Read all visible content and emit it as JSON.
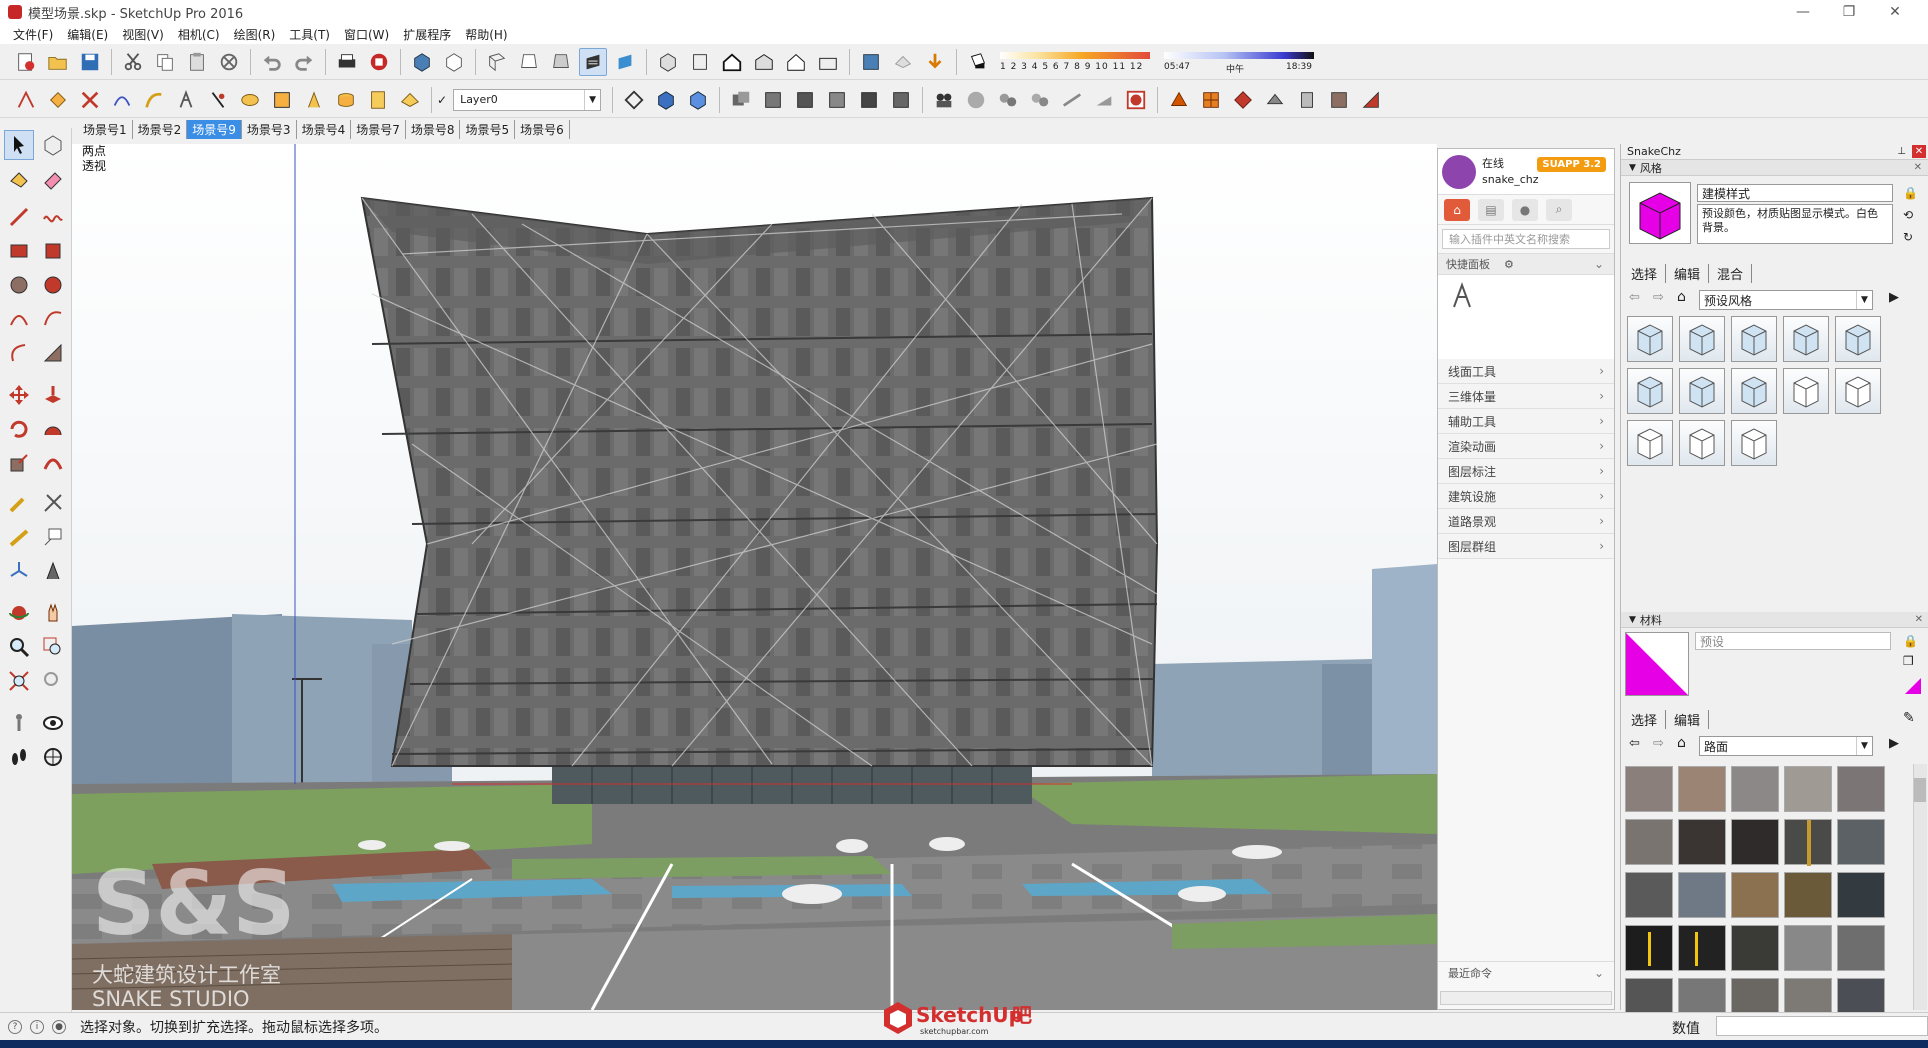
{
  "window": {
    "title": "模型场景.skp - SketchUp Pro 2016",
    "controls": [
      "—",
      "❐",
      "✕"
    ]
  },
  "menu": [
    "文件(F)",
    "编辑(E)",
    "视图(V)",
    "相机(C)",
    "绘图(R)",
    "工具(T)",
    "窗口(W)",
    "扩展程序",
    "帮助(H)"
  ],
  "toolbar2": {
    "layer_check": "✓",
    "layer_name": "Layer0",
    "shadow": {
      "months": "1 2 3 4 5 6 7 8 9 10 11 12",
      "time_start": "05:47",
      "time_mid": "中午",
      "time_end": "18:39"
    }
  },
  "scene_tabs": [
    "场景号1",
    "场景号2",
    "场景号9",
    "场景号3",
    "场景号4",
    "场景号7",
    "场景号8",
    "场景号5",
    "场景号6"
  ],
  "active_scene": "场景号9",
  "viewport": {
    "camera_line1": "两点",
    "camera_line2": "透视",
    "watermark_logo": "S&S",
    "watermark_cn": "大蛇建筑设计工作室",
    "watermark_en": "SNAKE STUDIO"
  },
  "plugin_panel": {
    "status": "在线",
    "user": "snake_chz",
    "badge": "SUAPP 3.2",
    "search_placeholder": "输入插件中英文名称搜索",
    "quick_panel": "快捷面板",
    "categories": [
      "线面工具",
      "三维体量",
      "辅助工具",
      "渲染动画",
      "图层标注",
      "建筑设施",
      "道路景观",
      "图层群组"
    ],
    "recent": "最近命令"
  },
  "tray": {
    "title": "SnakeChz",
    "styles": {
      "section": "风格",
      "name": "建模样式",
      "description": "预设颜色，材质贴图显示模式。白色背景。",
      "tabs": [
        "选择",
        "编辑",
        "混合"
      ],
      "dropdown": "预设风格",
      "count": 13
    },
    "materials": {
      "section": "材料",
      "name_placeholder": "预设",
      "tabs": [
        "选择",
        "编辑"
      ],
      "dropdown": "路面",
      "accent": "#e600e6"
    }
  },
  "status": {
    "message": "选择对象。切换到扩充选择。拖动鼠标选择多项。",
    "value_label": "数值"
  },
  "logo": {
    "text": "SketchUp",
    "suffix": "吧",
    "site": "sketchupbar.com"
  }
}
